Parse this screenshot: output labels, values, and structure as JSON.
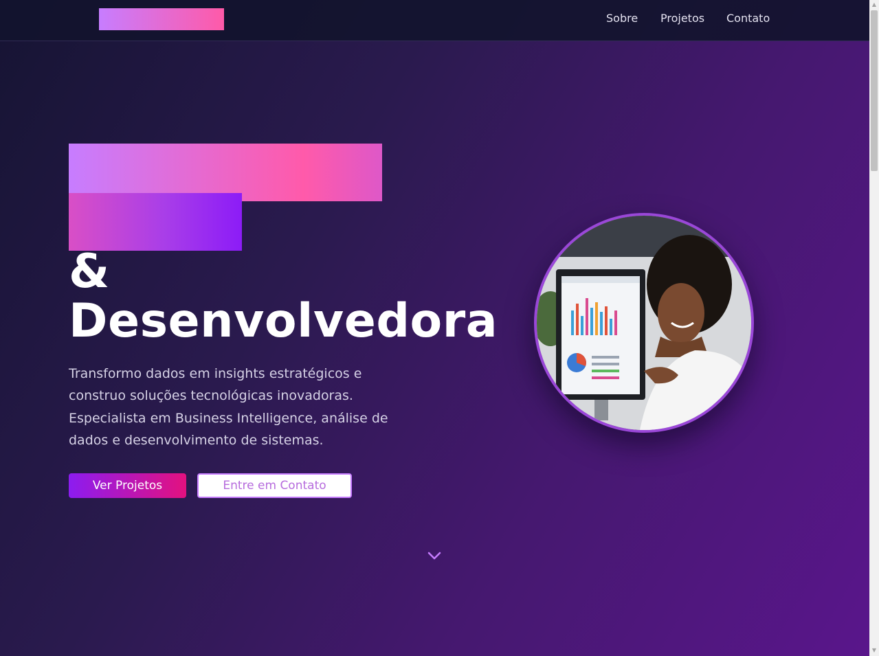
{
  "nav": {
    "links": [
      "Sobre",
      "Projetos",
      "Contato"
    ]
  },
  "hero": {
    "title_ampersand": "&",
    "title_word": "Desenvolvedora",
    "description": "Transformo dados em insights estratégicos e construo soluções tecnológicas inovadoras. Especialista em Business Intelligence, análise de dados e desenvolvimento de sistemas.",
    "primary_button": "Ver Projetos",
    "secondary_button": "Entre em Contato",
    "scroll_icon": "chevron-down-icon"
  },
  "colors": {
    "accent_purple": "#8c1cf0",
    "accent_pink": "#ff5aa8",
    "lilac": "#c77dff",
    "ring": "#9a47d8"
  }
}
